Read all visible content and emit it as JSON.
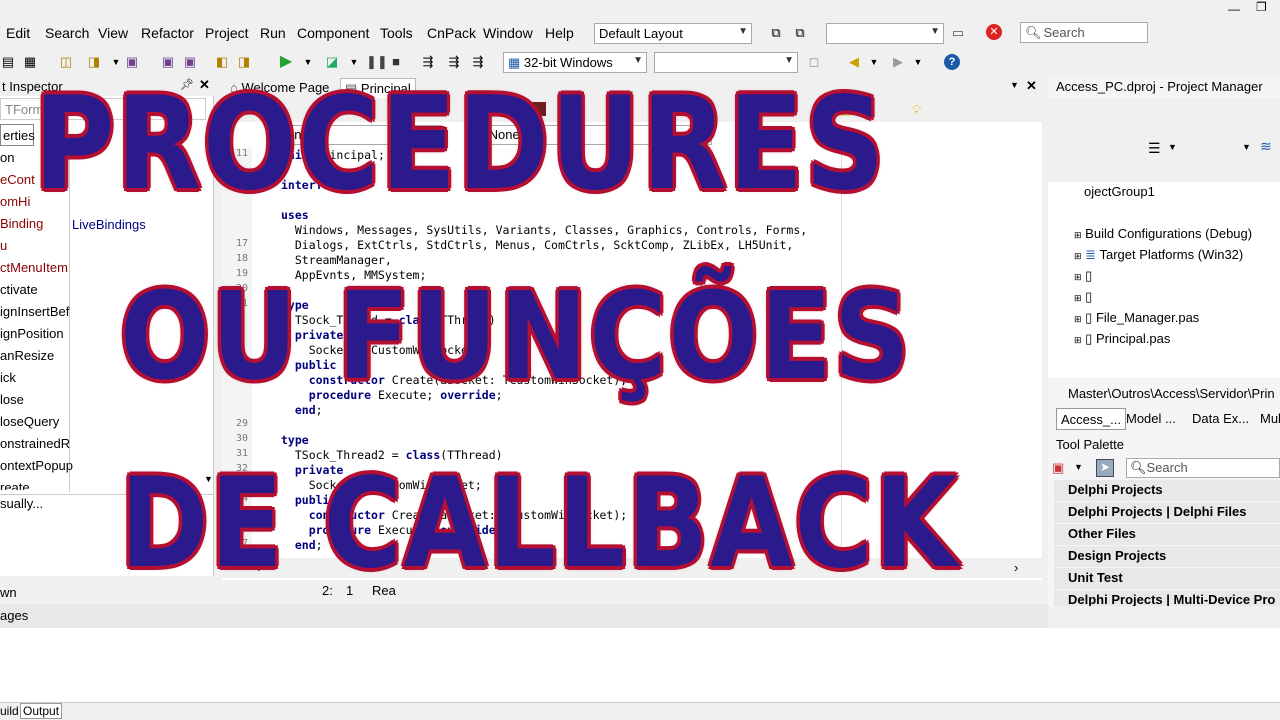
{
  "menu": {
    "items": [
      "Edit",
      "Search",
      "View",
      "Refactor",
      "Project",
      "Run",
      "Component",
      "Tools",
      "CnPack",
      "Window",
      "Help"
    ],
    "layout_combo": "Default Layout",
    "search_placeholder": "Search"
  },
  "toolbar": {
    "platform_combo": "32-bit Windows"
  },
  "object_inspector": {
    "title": "t Inspector",
    "form_combo": "TForm",
    "tab_properties": "erties",
    "rows": [
      "on",
      "eCont",
      "omHi",
      "Binding",
      "u",
      "ctMenuItem",
      "ctivate",
      "ignInsertBef",
      "ignPosition",
      "anResize",
      "ick",
      "lose",
      "loseQuery",
      "onstrainedR",
      "ontextPopup",
      "reate"
    ],
    "livebindings": "LiveBindings",
    "bottom_link": "sually...",
    "status_left": "wn",
    "pages_label": "ages"
  },
  "editor": {
    "tab_welcome": "Welcome Page",
    "tab_principal": "Principal",
    "combo1": "one>",
    "combo2": "<None>",
    "status_pos": "2:",
    "status_col": "1",
    "status_mode": "Rea",
    "lines": [
      {
        "n": "11",
        "t": "unit Principal;"
      },
      {
        "n": "",
        "t": ""
      },
      {
        "n": "",
        "t": "interface"
      },
      {
        "n": "",
        "t": ""
      },
      {
        "n": "",
        "t": "uses"
      },
      {
        "n": "",
        "t": "  Windows, Messages, SysUtils, Variants, Classes, Graphics, Controls, Forms,"
      },
      {
        "n": "17",
        "t": "  Dialogs, ExtCtrls, StdCtrls, Menus, ComCtrls, ScktComp, ZLibEx, LH5Unit,"
      },
      {
        "n": "18",
        "t": "  StreamManager,"
      },
      {
        "n": "19",
        "t": "  AppEvnts, MMSystem;"
      },
      {
        "n": "20",
        "t": ""
      },
      {
        "n": "21",
        "t": "type"
      },
      {
        "n": "",
        "t": "  TSock_Thread = class(TThread)"
      },
      {
        "n": "",
        "t": "  private"
      },
      {
        "n": "",
        "t": "    Socket: TCustomWinSocket;"
      },
      {
        "n": "",
        "t": "  public"
      },
      {
        "n": "",
        "t": "    constructor Create(aSocket: TCustomWinSocket);"
      },
      {
        "n": "",
        "t": "    procedure Execute; override;"
      },
      {
        "n": "",
        "t": "  end;"
      },
      {
        "n": "29",
        "t": ""
      },
      {
        "n": "30",
        "t": "type"
      },
      {
        "n": "31",
        "t": "  TSock_Thread2 = class(TThread)"
      },
      {
        "n": "32",
        "t": "  private"
      },
      {
        "n": "33",
        "t": "    Socket: TCustomWinSocket;"
      },
      {
        "n": "34",
        "t": "  public"
      },
      {
        "n": "35",
        "t": "    constructor Create(aSocket: TCustomWinSocket);"
      },
      {
        "n": "36",
        "t": "    procedure Execute; override;"
      },
      {
        "n": "37",
        "t": "  end;"
      }
    ]
  },
  "project_manager": {
    "title": "Access_PC.dproj - Project Manager",
    "group": "ojectGroup1",
    "build_config": "Build Configurations (Debug)",
    "target": "Target Platforms (Win32)",
    "file1": "File_Manager.pas",
    "file2": "Principal.pas",
    "path": "Master\\Outros\\Access\\Servidor\\Prin",
    "tabs": [
      "Access_...",
      "Model ...",
      "Data Ex...",
      "Mult"
    ]
  },
  "tool_palette": {
    "title": "Tool Palette",
    "search_placeholder": "Search",
    "categories": [
      "Delphi Projects",
      "Delphi Projects | Delphi Files",
      "Other Files",
      "Design Projects",
      "Unit Test",
      "Delphi Projects | Multi-Device Pro"
    ]
  },
  "bottom_tabs": [
    "uild",
    "Output"
  ],
  "overlay": {
    "line1": "PROCEDURES",
    "line2": "OU FUNÇÕES",
    "line3": "DE CALLBACK"
  },
  "colors": {
    "overlay_text": "#2a1a8c",
    "overlay_outline": "#b01030",
    "keyword": "#00007f"
  }
}
